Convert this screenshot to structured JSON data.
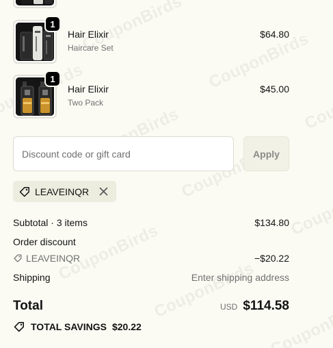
{
  "items": [
    {
      "title": "Hair Elixir",
      "variant": "Haircare Set",
      "price": "$64.80",
      "qty": "1",
      "image": "haircare-set-image"
    },
    {
      "title": "Hair Elixir",
      "variant": "Two Pack",
      "price": "$45.00",
      "qty": "1",
      "image": "two-pack-image"
    }
  ],
  "discount": {
    "placeholder": "Discount code or gift card",
    "apply_label": "Apply",
    "applied_code": "LEAVEINQR"
  },
  "summary": {
    "subtotal_label": "Subtotal · 3 items",
    "subtotal_value": "$134.80",
    "order_discount_label": "Order discount",
    "discount_code": "LEAVEINQR",
    "discount_value": "−$20.22",
    "shipping_label": "Shipping",
    "shipping_value": "Enter shipping address",
    "total_label": "Total",
    "currency": "USD",
    "total_value": "$114.58",
    "savings_label": "TOTAL SAVINGS",
    "savings_value": "$20.22"
  },
  "watermark": "CouponBirds",
  "colors": {
    "background": "#fbfbf4",
    "badge": "#000000",
    "chip": "#ececdf",
    "apply_button": "#f1f1e6"
  }
}
